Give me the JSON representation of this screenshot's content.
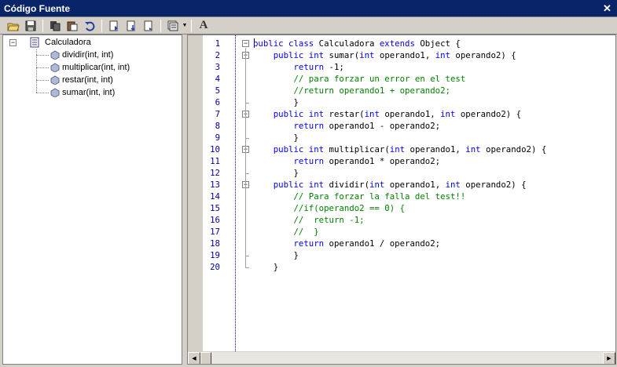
{
  "window": {
    "title": "Código Fuente"
  },
  "toolbar": {
    "buttons": [
      {
        "name": "open-icon"
      },
      {
        "name": "save-icon"
      },
      {
        "name": "copy-icon"
      },
      {
        "name": "paste-icon"
      },
      {
        "name": "undo-icon"
      },
      {
        "name": "bookmark-toggle-icon"
      },
      {
        "name": "bookmark-next-icon"
      },
      {
        "name": "bookmark-prev-icon"
      },
      {
        "name": "view-options-icon"
      },
      {
        "name": "font-icon"
      }
    ],
    "font_label": "A"
  },
  "tree": {
    "root": {
      "label": "Calculadora",
      "expanded": true
    },
    "methods": [
      "dividir(int, int)",
      "multiplicar(int, int)",
      "restar(int, int)",
      "sumar(int, int)"
    ]
  },
  "code": {
    "line_numbers": [
      "1",
      "2",
      "3",
      "4",
      "5",
      "6",
      "7",
      "8",
      "9",
      "10",
      "11",
      "12",
      "13",
      "14",
      "15",
      "16",
      "17",
      "18",
      "19",
      "20"
    ],
    "lines": [
      [
        {
          "t": "public class",
          "c": "kw"
        },
        {
          "t": " Calculadora "
        },
        {
          "t": "extends",
          "c": "kw"
        },
        {
          "t": " Object {"
        }
      ],
      [
        {
          "t": "    "
        },
        {
          "t": "public int",
          "c": "kw"
        },
        {
          "t": " sumar("
        },
        {
          "t": "int",
          "c": "kw"
        },
        {
          "t": " operando1, "
        },
        {
          "t": "int",
          "c": "kw"
        },
        {
          "t": " operando2) {"
        }
      ],
      [
        {
          "t": "        "
        },
        {
          "t": "return",
          "c": "kw"
        },
        {
          "t": " -1;"
        }
      ],
      [
        {
          "t": "        "
        },
        {
          "t": "// para forzar un error en el test",
          "c": "cm"
        }
      ],
      [
        {
          "t": "        "
        },
        {
          "t": "//return operando1 + operando2;",
          "c": "cm"
        }
      ],
      [
        {
          "t": "        }"
        }
      ],
      [
        {
          "t": "    "
        },
        {
          "t": "public int",
          "c": "kw"
        },
        {
          "t": " restar("
        },
        {
          "t": "int",
          "c": "kw"
        },
        {
          "t": " operando1, "
        },
        {
          "t": "int",
          "c": "kw"
        },
        {
          "t": " operando2) {"
        }
      ],
      [
        {
          "t": "        "
        },
        {
          "t": "return",
          "c": "kw"
        },
        {
          "t": " operando1 - operando2;"
        }
      ],
      [
        {
          "t": "        }"
        }
      ],
      [
        {
          "t": "    "
        },
        {
          "t": "public int",
          "c": "kw"
        },
        {
          "t": " multiplicar("
        },
        {
          "t": "int",
          "c": "kw"
        },
        {
          "t": " operando1, "
        },
        {
          "t": "int",
          "c": "kw"
        },
        {
          "t": " operando2) {"
        }
      ],
      [
        {
          "t": "        "
        },
        {
          "t": "return",
          "c": "kw"
        },
        {
          "t": " operando1 * operando2;"
        }
      ],
      [
        {
          "t": "        }"
        }
      ],
      [
        {
          "t": "    "
        },
        {
          "t": "public int",
          "c": "kw"
        },
        {
          "t": " dividir("
        },
        {
          "t": "int",
          "c": "kw"
        },
        {
          "t": " operando1, "
        },
        {
          "t": "int",
          "c": "kw"
        },
        {
          "t": " operando2) {"
        }
      ],
      [
        {
          "t": "        "
        },
        {
          "t": "// Para forzar la falla del test!!",
          "c": "cm"
        }
      ],
      [
        {
          "t": "        "
        },
        {
          "t": "//if(operando2 == 0) {",
          "c": "cm"
        }
      ],
      [
        {
          "t": "        "
        },
        {
          "t": "//  return -1;",
          "c": "cm"
        }
      ],
      [
        {
          "t": "        "
        },
        {
          "t": "//  }",
          "c": "cm"
        }
      ],
      [
        {
          "t": "        "
        },
        {
          "t": "return",
          "c": "kw"
        },
        {
          "t": " operando1 / operando2;"
        }
      ],
      [
        {
          "t": "        }"
        }
      ],
      [
        {
          "t": "    }"
        }
      ]
    ]
  },
  "colors": {
    "keyword": "#0000ff",
    "comment": "#008000",
    "line_number": "#0000a0",
    "titlebar": "#0a246a"
  }
}
